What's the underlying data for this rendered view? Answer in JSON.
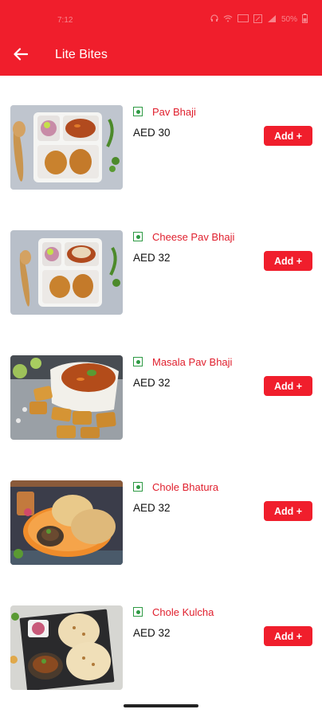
{
  "status_bar": {
    "time": "7:12",
    "battery": "50%"
  },
  "header": {
    "title": "Lite Bites",
    "back_icon": "arrow-left-icon"
  },
  "colors": {
    "brand_red": "#f01e2c",
    "veg_green": "#2e9a44"
  },
  "items": [
    {
      "name": "Pav Bhaji",
      "price": "AED 30",
      "add_label": "Add +"
    },
    {
      "name": "Cheese Pav Bhaji",
      "price": "AED 32",
      "add_label": "Add +"
    },
    {
      "name": "Masala Pav Bhaji",
      "price": "AED 32",
      "add_label": "Add +"
    },
    {
      "name": "Chole Bhatura",
      "price": "AED 32",
      "add_label": "Add +"
    },
    {
      "name": "Chole Kulcha",
      "price": "AED 32",
      "add_label": "Add +"
    }
  ]
}
